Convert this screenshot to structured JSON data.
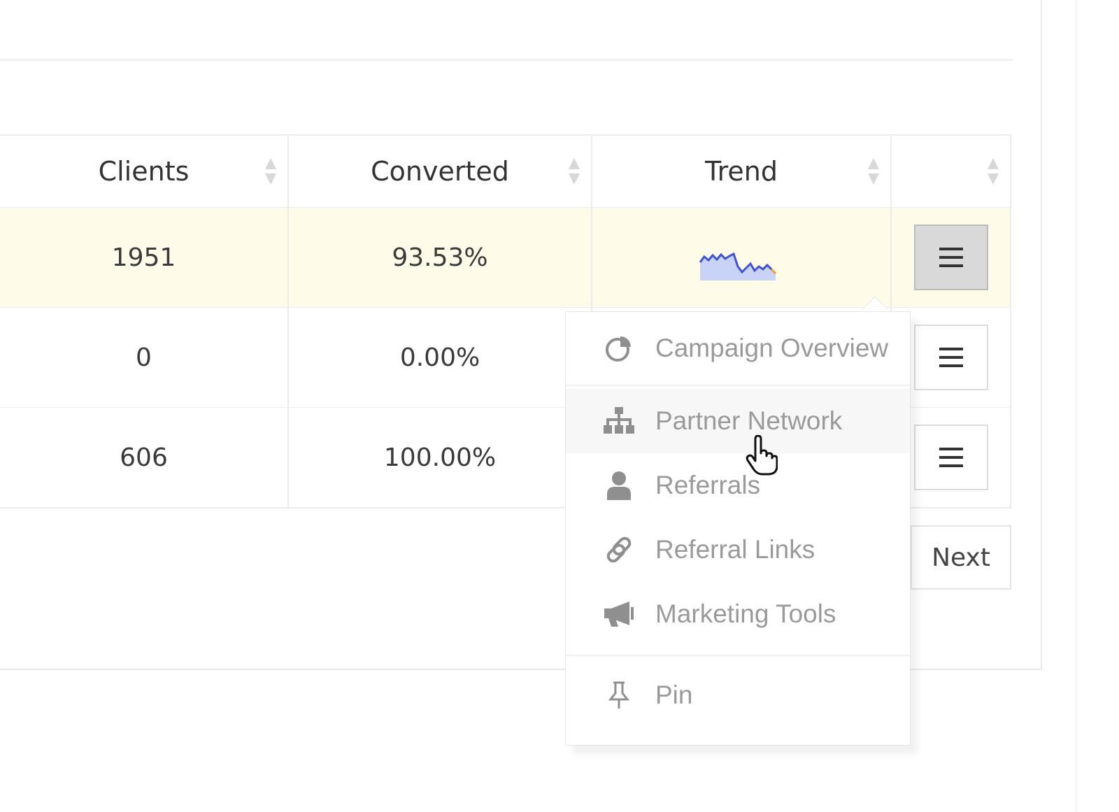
{
  "table": {
    "headers": [
      "Clients",
      "Converted",
      "Trend",
      ""
    ],
    "rows": [
      {
        "clients": "1951",
        "converted": "93.53%"
      },
      {
        "clients": "0",
        "converted": "0.00%"
      },
      {
        "clients": "606",
        "converted": "100.00%"
      }
    ]
  },
  "pagination": {
    "next_label": "Next"
  },
  "dropdown": {
    "items": [
      {
        "label": "Campaign Overview",
        "icon": "pie-chart-icon"
      },
      {
        "label": "Partner Network",
        "icon": "sitemap-icon"
      },
      {
        "label": "Referrals",
        "icon": "user-icon"
      },
      {
        "label": "Referral Links",
        "icon": "link-icon"
      },
      {
        "label": "Marketing Tools",
        "icon": "megaphone-icon"
      },
      {
        "label": "Pin",
        "icon": "pin-icon"
      }
    ],
    "hovered": "Partner Network"
  },
  "colors": {
    "selected_row": "#fffbe9",
    "trend_line": "#3f51d8",
    "trend_fill": "#c9d2f7",
    "trend_highlight": "#f5a623"
  }
}
